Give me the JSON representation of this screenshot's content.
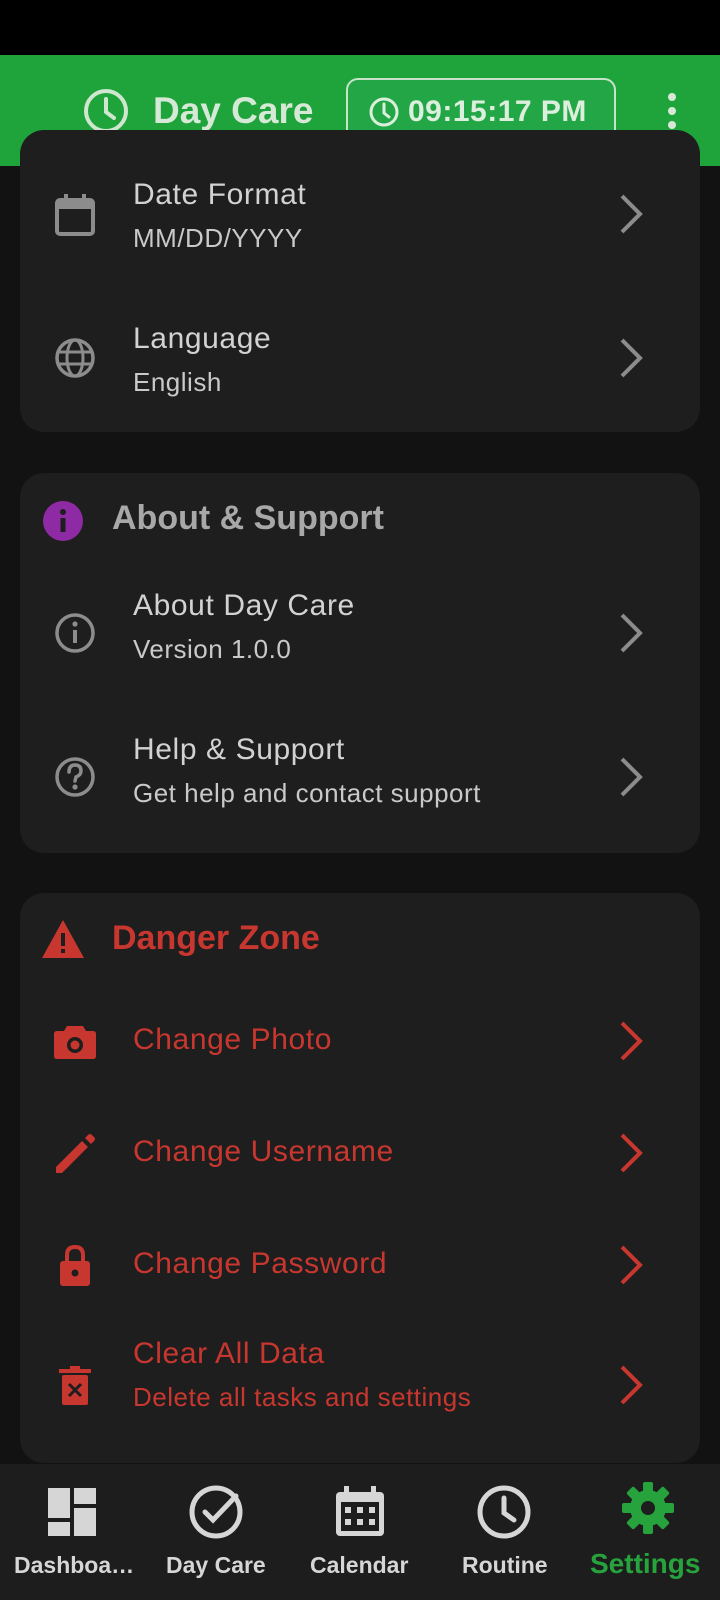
{
  "app_bar": {
    "title": "Day Care",
    "time": "09:15:17 PM",
    "icons": [
      "clock-icon",
      "clock-icon",
      "more-vert-icon"
    ]
  },
  "general_card": {
    "items": [
      {
        "label": "Date Format",
        "value": "MM/DD/YYYY",
        "icon": "calendar-icon"
      },
      {
        "label": "Language",
        "value": "English",
        "icon": "globe-icon"
      }
    ]
  },
  "about_card": {
    "title": "About & Support",
    "title_icon": "info-filled-icon",
    "items": [
      {
        "label": "About Day Care",
        "value": "Version 1.0.0",
        "icon": "info-outline-icon"
      },
      {
        "label": "Help & Support",
        "value": "Get help and contact support",
        "icon": "help-icon"
      }
    ]
  },
  "danger_card": {
    "title": "Danger Zone",
    "title_icon": "warning-icon",
    "items": [
      {
        "label": "Change Photo",
        "icon": "camera-icon"
      },
      {
        "label": "Change Username",
        "icon": "pencil-icon"
      },
      {
        "label": "Change Password",
        "icon": "lock-icon"
      },
      {
        "label": "Clear All Data",
        "value": "Delete all tasks and settings",
        "icon": "delete-icon"
      }
    ]
  },
  "bottom_nav": {
    "items": [
      {
        "label": "Dashboa…",
        "icon": "dashboard-icon"
      },
      {
        "label": "Day Care",
        "icon": "check-circle-icon"
      },
      {
        "label": "Calendar",
        "icon": "calendar-icon"
      },
      {
        "label": "Routine",
        "icon": "clock-icon"
      },
      {
        "label": "Settings",
        "icon": "gear-icon"
      }
    ],
    "active_index": 4
  },
  "colors": {
    "app_bar": "#1fa33b",
    "background": "#121212",
    "card": "#1e1e1e",
    "danger": "#c8372f",
    "about_icon": "#8e2aa3",
    "active_nav": "#26a33c"
  }
}
